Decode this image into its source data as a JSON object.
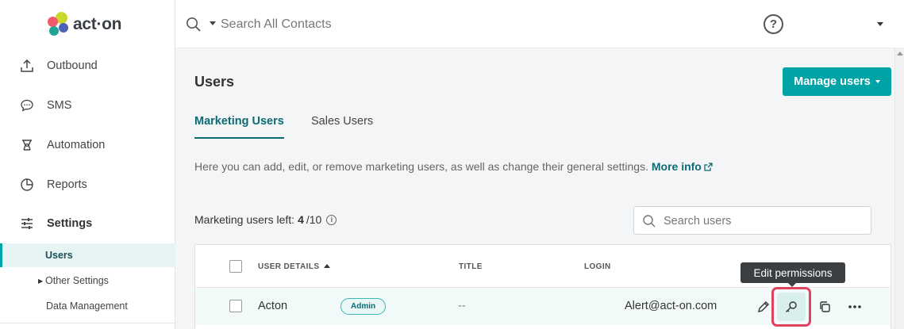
{
  "app": {
    "logo_text": "act·on",
    "colors": {
      "accent": "#00a4a6",
      "accent_dark": "#0d6b73",
      "highlight_ring": "#e0435e"
    }
  },
  "sidebar": {
    "items": [
      {
        "label": "Outbound",
        "icon": "upload-icon"
      },
      {
        "label": "SMS",
        "icon": "chat-bubble-icon"
      },
      {
        "label": "Automation",
        "icon": "automation-icon"
      },
      {
        "label": "Reports",
        "icon": "pie-chart-icon"
      },
      {
        "label": "Settings",
        "icon": "sliders-icon"
      }
    ],
    "sub_items": [
      {
        "label": "Users"
      },
      {
        "label": "Other Settings"
      },
      {
        "label": "Data Management"
      }
    ]
  },
  "header": {
    "search_placeholder": "Search All Contacts",
    "help_label": "?"
  },
  "main": {
    "title": "Users",
    "manage_button": "Manage users",
    "tabs": [
      {
        "label": "Marketing Users"
      },
      {
        "label": "Sales Users"
      }
    ],
    "description": "Here you can add, edit, or remove marketing users, as well as change their general settings.",
    "more_info": "More info",
    "users_left_label": "Marketing users left:",
    "users_left_count": "4",
    "users_left_total": "/10",
    "search_users_placeholder": "Search users"
  },
  "table": {
    "columns": [
      "USER DETAILS",
      "TITLE",
      "LOGIN"
    ],
    "rows": [
      {
        "name": "Acton",
        "badge": "Admin",
        "title": "--",
        "login": "Alert@act-on.com"
      }
    ]
  },
  "tooltip": {
    "text": "Edit permissions"
  }
}
